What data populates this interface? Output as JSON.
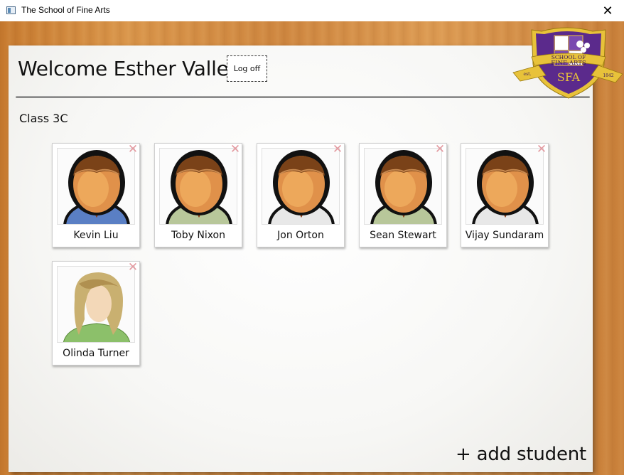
{
  "window": {
    "title": "The School of Fine Arts",
    "close_glyph": "✕"
  },
  "header": {
    "welcome": "Welcome Esther Valle!",
    "logoff_label": "Log off"
  },
  "crest": {
    "line1": "SCHOOL OF",
    "line2": "FINE ARTS",
    "initials": "SFA",
    "est": "est.",
    "year": "1842"
  },
  "class_name": "Class 3C",
  "students": [
    {
      "name": "Kevin Liu",
      "avatar": "male-avatar-icon",
      "shirt": "#5a7fc4"
    },
    {
      "name": "Toby Nixon",
      "avatar": "male-avatar-icon",
      "shirt": "#b8c79a"
    },
    {
      "name": "Jon Orton",
      "avatar": "male-avatar-icon",
      "shirt": "#e8e8e8"
    },
    {
      "name": "Sean Stewart",
      "avatar": "male-avatar-icon",
      "shirt": "#b8c79a"
    },
    {
      "name": "Vijay Sundaram",
      "avatar": "male-avatar-icon",
      "shirt": "#e8e8e8"
    },
    {
      "name": "Olinda Turner",
      "avatar": "female-avatar-icon",
      "shirt": "#8cc06a"
    }
  ],
  "remove_glyph": "✕",
  "add_student_label": "+ add student",
  "colors": {
    "crest_purple": "#5b2a8c",
    "crest_gold": "#e8c23a",
    "remove_pink": "#e39aa0"
  }
}
